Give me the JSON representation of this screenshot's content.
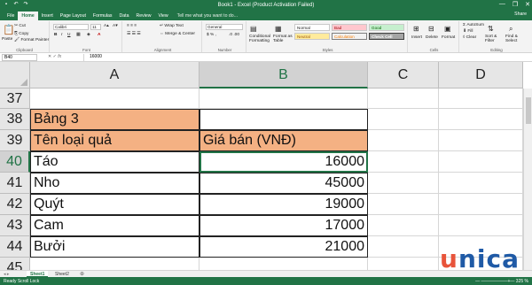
{
  "window": {
    "title": "Book1 - Excel (Product Activation Failed)",
    "controls": [
      "—",
      "❐",
      "✕"
    ]
  },
  "tabs": [
    "File",
    "Home",
    "Insert",
    "Page Layout",
    "Formulas",
    "Data",
    "Review",
    "View"
  ],
  "tell_me": "Tell me what you want to do...",
  "share": "Share",
  "ribbon": {
    "clipboard": {
      "paste": "Paste",
      "cut": "Cut",
      "copy": "Copy",
      "format_painter": "Format Painter",
      "label": "Clipboard"
    },
    "font": {
      "name": "Calibri",
      "size": "11",
      "label": "Font"
    },
    "alignment": {
      "wrap_text": "Wrap Text",
      "merge_center": "Merge & Center",
      "label": "Alignment"
    },
    "number": {
      "format": "General",
      "label": "Number"
    },
    "styles": {
      "conditional": "Conditional Formatting",
      "format_as_table": "Format as Table",
      "cells": [
        "Normal",
        "Bad",
        "Good",
        "Neutral",
        "Calculation",
        "Check Cell"
      ],
      "label": "Styles"
    },
    "cells": {
      "insert": "Insert",
      "delete": "Delete",
      "format": "Format",
      "label": "Cells"
    },
    "editing": {
      "autosum": "AutoSum",
      "fill": "Fill",
      "clear": "Clear",
      "sort_filter": "Sort & Filter",
      "find_select": "Find & Select",
      "label": "Editing"
    }
  },
  "formula_bar": {
    "name_box": "B40",
    "value": "16000"
  },
  "columns": [
    "A",
    "B",
    "C",
    "D"
  ],
  "rows": [
    {
      "num": "37",
      "a": "",
      "b": ""
    },
    {
      "num": "38",
      "a": "Bảng 3",
      "b": ""
    },
    {
      "num": "39",
      "a": "Tên loại quả",
      "b": "Giá bán (VNĐ)"
    },
    {
      "num": "40",
      "a": "Táo",
      "b": "16000"
    },
    {
      "num": "41",
      "a": "Nho",
      "b": "45000"
    },
    {
      "num": "42",
      "a": "Quýt",
      "b": "19000"
    },
    {
      "num": "43",
      "a": "Cam",
      "b": "17000"
    },
    {
      "num": "44",
      "a": "Bưởi",
      "b": "21000"
    },
    {
      "num": "45",
      "a": "",
      "b": ""
    }
  ],
  "sheets": [
    "Sheet1",
    "Sheet2"
  ],
  "status": {
    "left": "Ready    Scroll Lock",
    "right": "— ——————+— 325 %"
  },
  "logo": {
    "first": "u",
    "rest": "nica"
  },
  "colors": {
    "excel_green": "#217346",
    "header_orange": "#f4b183",
    "logo_blue": "#1f5aa6",
    "logo_orange": "#e8543b"
  }
}
